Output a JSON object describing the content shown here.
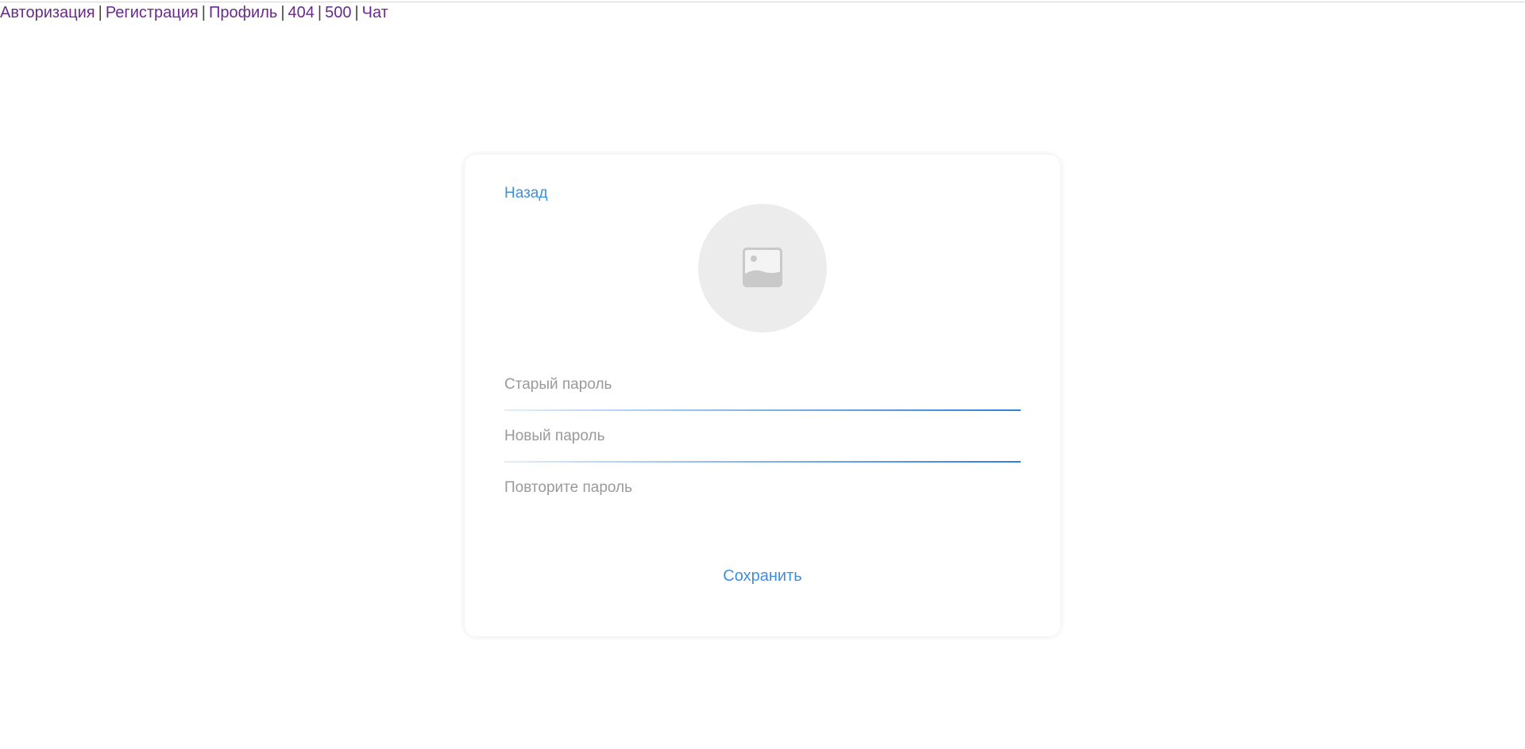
{
  "nav": {
    "links": [
      {
        "label": "Авторизация"
      },
      {
        "label": "Регистрация"
      },
      {
        "label": "Профиль"
      },
      {
        "label": "404"
      },
      {
        "label": "500"
      },
      {
        "label": "Чат"
      }
    ],
    "separator": "|"
  },
  "card": {
    "back_label": "Назад",
    "avatar_icon": "image-placeholder-icon",
    "fields": [
      {
        "placeholder": "Старый пароль",
        "value": ""
      },
      {
        "placeholder": "Новый пароль",
        "value": ""
      },
      {
        "placeholder": "Повторите пароль",
        "value": ""
      }
    ],
    "save_label": "Сохранить"
  },
  "colors": {
    "nav_link": "#6a2a8c",
    "accent": "#3d8fe0",
    "avatar_bg": "#ececec",
    "placeholder": "#9a9a9a"
  }
}
